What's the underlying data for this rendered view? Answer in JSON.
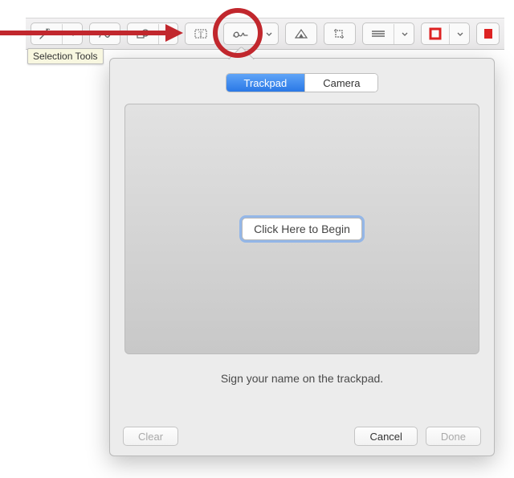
{
  "toolbar": {
    "tooltip": "Selection Tools"
  },
  "popover": {
    "tabs": {
      "trackpad": "Trackpad",
      "camera": "Camera"
    },
    "begin_label": "Click Here to Begin",
    "hint": "Sign your name on the trackpad.",
    "buttons": {
      "clear": "Clear",
      "cancel": "Cancel",
      "done": "Done"
    }
  },
  "icons": {
    "selection": "selection-wand-icon",
    "draw": "draw-icon",
    "shapes": "shapes-icon",
    "text": "text-icon",
    "sign": "sign-icon",
    "adjust": "adjust-color-icon",
    "crop": "crop-icon",
    "line": "line-style-icon",
    "border": "border-color-icon"
  }
}
